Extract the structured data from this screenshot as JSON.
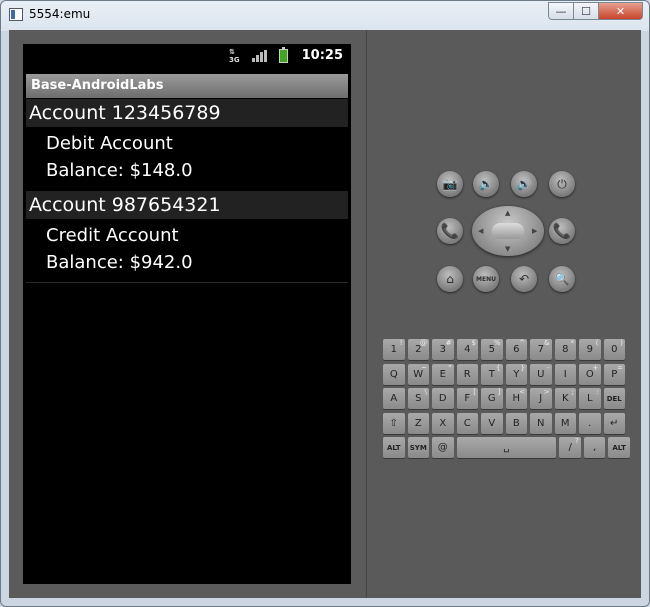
{
  "window": {
    "title": "5554:emu",
    "min_label": "—",
    "max_label": "☐",
    "close_label": "✕"
  },
  "status_bar": {
    "network": "3G",
    "network_top": "⇅",
    "time": "10:25"
  },
  "app": {
    "title": "Base-AndroidLabs"
  },
  "accounts": [
    {
      "header": "Account 123456789",
      "type": "Debit Account",
      "balance": "Balance: $148.0"
    },
    {
      "header": "Account 987654321",
      "type": "Credit Account",
      "balance": "Balance: $942.0"
    }
  ],
  "controls": {
    "camera": "📷",
    "vol_down": "🔉",
    "vol_up": "🔊",
    "power": "⏻",
    "call": "📞",
    "end": "📞",
    "home": "⌂",
    "menu": "MENU",
    "back": "↶",
    "search": "🔍"
  },
  "keyboard": {
    "rows": [
      [
        [
          "1",
          "!"
        ],
        [
          "2",
          "@"
        ],
        [
          "3",
          "#"
        ],
        [
          "4",
          "$"
        ],
        [
          "5",
          "%"
        ],
        [
          "6",
          "^"
        ],
        [
          "7",
          "&"
        ],
        [
          "8",
          "*"
        ],
        [
          "9",
          "("
        ],
        [
          "0",
          ")"
        ]
      ],
      [
        [
          "Q",
          ""
        ],
        [
          "W",
          "~"
        ],
        [
          "E",
          "\""
        ],
        [
          "R",
          ""
        ],
        [
          "T",
          "{"
        ],
        [
          "Y",
          "}"
        ],
        [
          "U",
          "-"
        ],
        [
          "I",
          ""
        ],
        [
          "O",
          "+"
        ],
        [
          "P",
          "="
        ]
      ],
      [
        [
          "A",
          ""
        ],
        [
          "S",
          "\\"
        ],
        [
          "D",
          ""
        ],
        [
          "F",
          "["
        ],
        [
          "G",
          "]"
        ],
        [
          "H",
          "<"
        ],
        [
          "J",
          ">"
        ],
        [
          "K",
          ";"
        ],
        [
          "L",
          ":"
        ],
        [
          "DEL",
          ""
        ]
      ],
      [
        [
          "⇧",
          ""
        ],
        [
          "Z",
          ""
        ],
        [
          "X",
          ""
        ],
        [
          "C",
          ""
        ],
        [
          "V",
          ""
        ],
        [
          "B",
          ""
        ],
        [
          "N",
          ""
        ],
        [
          "M",
          ""
        ],
        [
          ".",
          ""
        ],
        [
          "↵",
          ""
        ]
      ],
      [
        [
          "ALT",
          ""
        ],
        [
          "SYM",
          ""
        ],
        [
          "@",
          ""
        ],
        [
          "␣",
          ""
        ],
        [
          "/",
          "?"
        ],
        [
          ",",
          ""
        ],
        [
          "ALT",
          ""
        ]
      ]
    ]
  }
}
